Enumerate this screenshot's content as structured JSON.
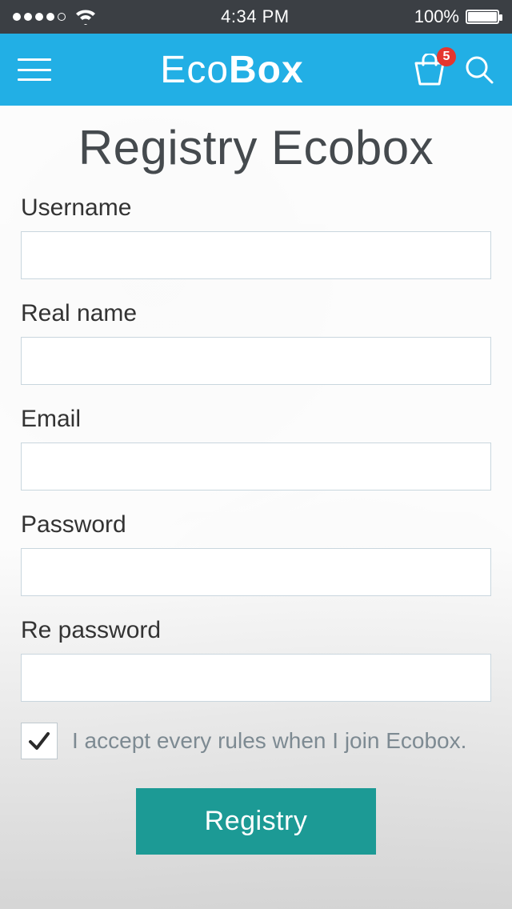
{
  "status": {
    "time": "4:34 PM",
    "battery_text": "100%"
  },
  "header": {
    "brand_light": "Eco",
    "brand_bold": "Box",
    "cart_badge": "5"
  },
  "page": {
    "title": "Registry Ecobox"
  },
  "form": {
    "username_label": "Username",
    "username_value": "",
    "realname_label": "Real name",
    "realname_value": "",
    "email_label": "Email",
    "email_value": "",
    "password_label": "Password",
    "password_value": "",
    "repassword_label": "Re password",
    "repassword_value": "",
    "accept_text": "I accept every rules when I join Ecobox.",
    "accept_checked": true,
    "submit_label": "Registry"
  },
  "colors": {
    "header_bg": "#22afe5",
    "submit_bg": "#1c9a95",
    "badge_bg": "#e5362f"
  }
}
